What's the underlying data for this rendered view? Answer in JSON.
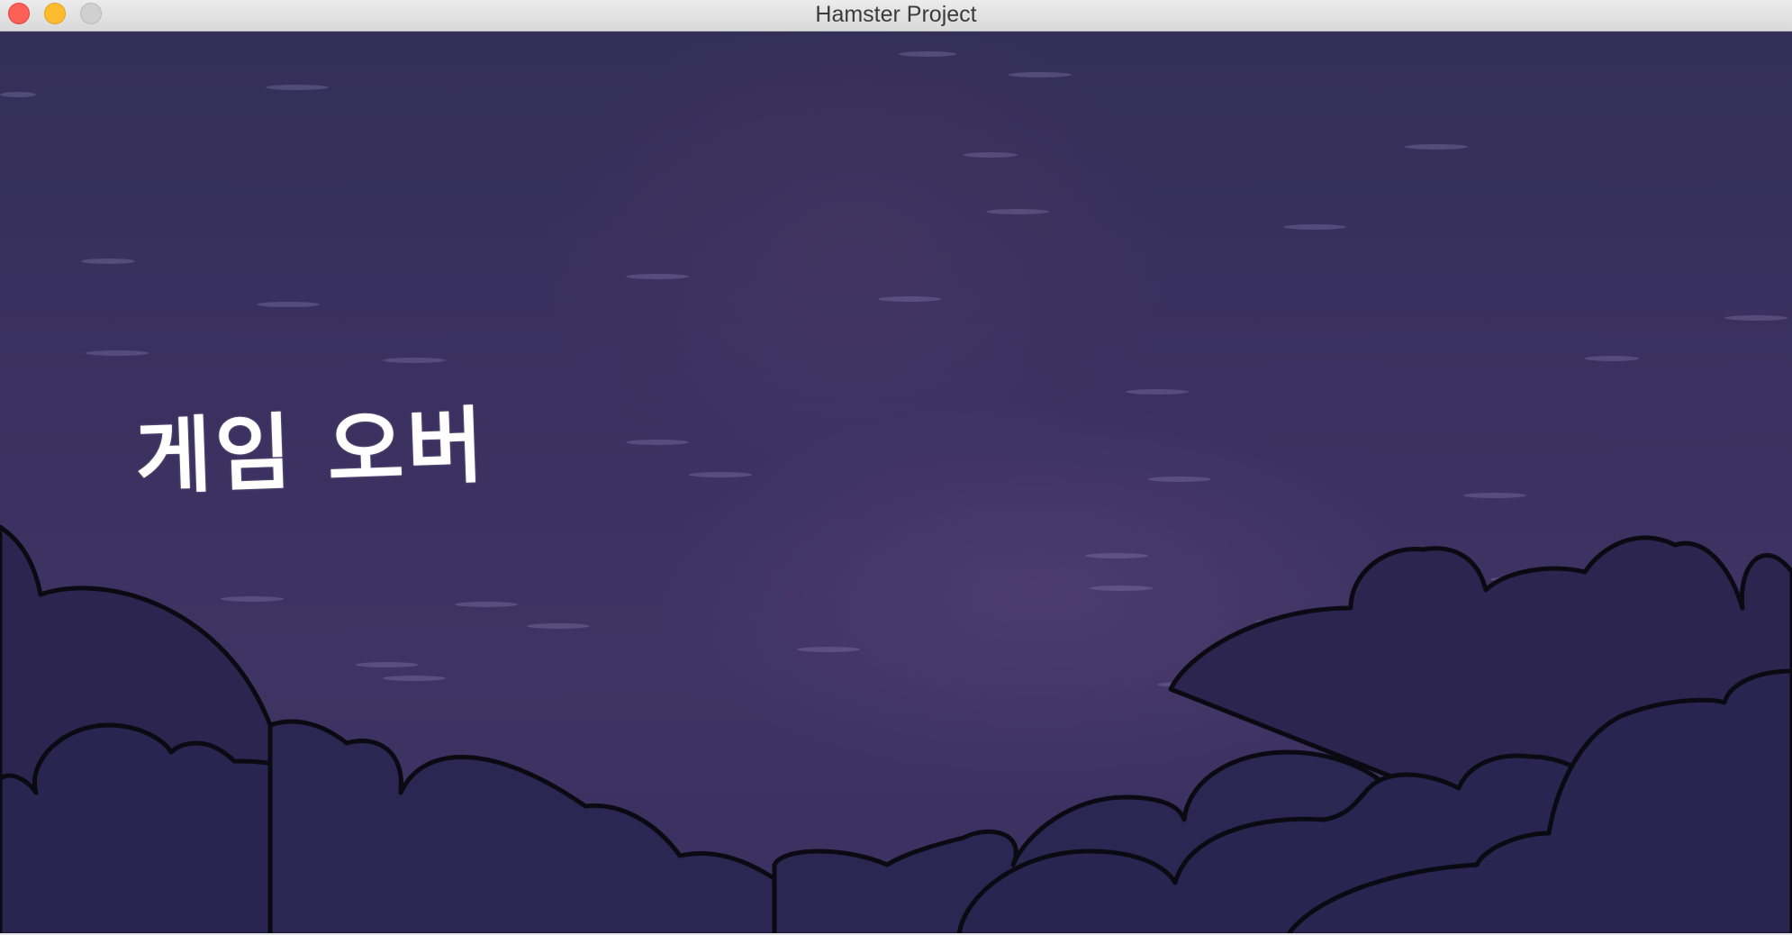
{
  "window": {
    "title": "Hamster Project"
  },
  "game": {
    "status_text": "게임 오버"
  },
  "colors": {
    "sky": "#3a3160",
    "cloud_fill": "#2b2550",
    "cloud_outline": "#0b0a12",
    "text": "#ffffff"
  }
}
